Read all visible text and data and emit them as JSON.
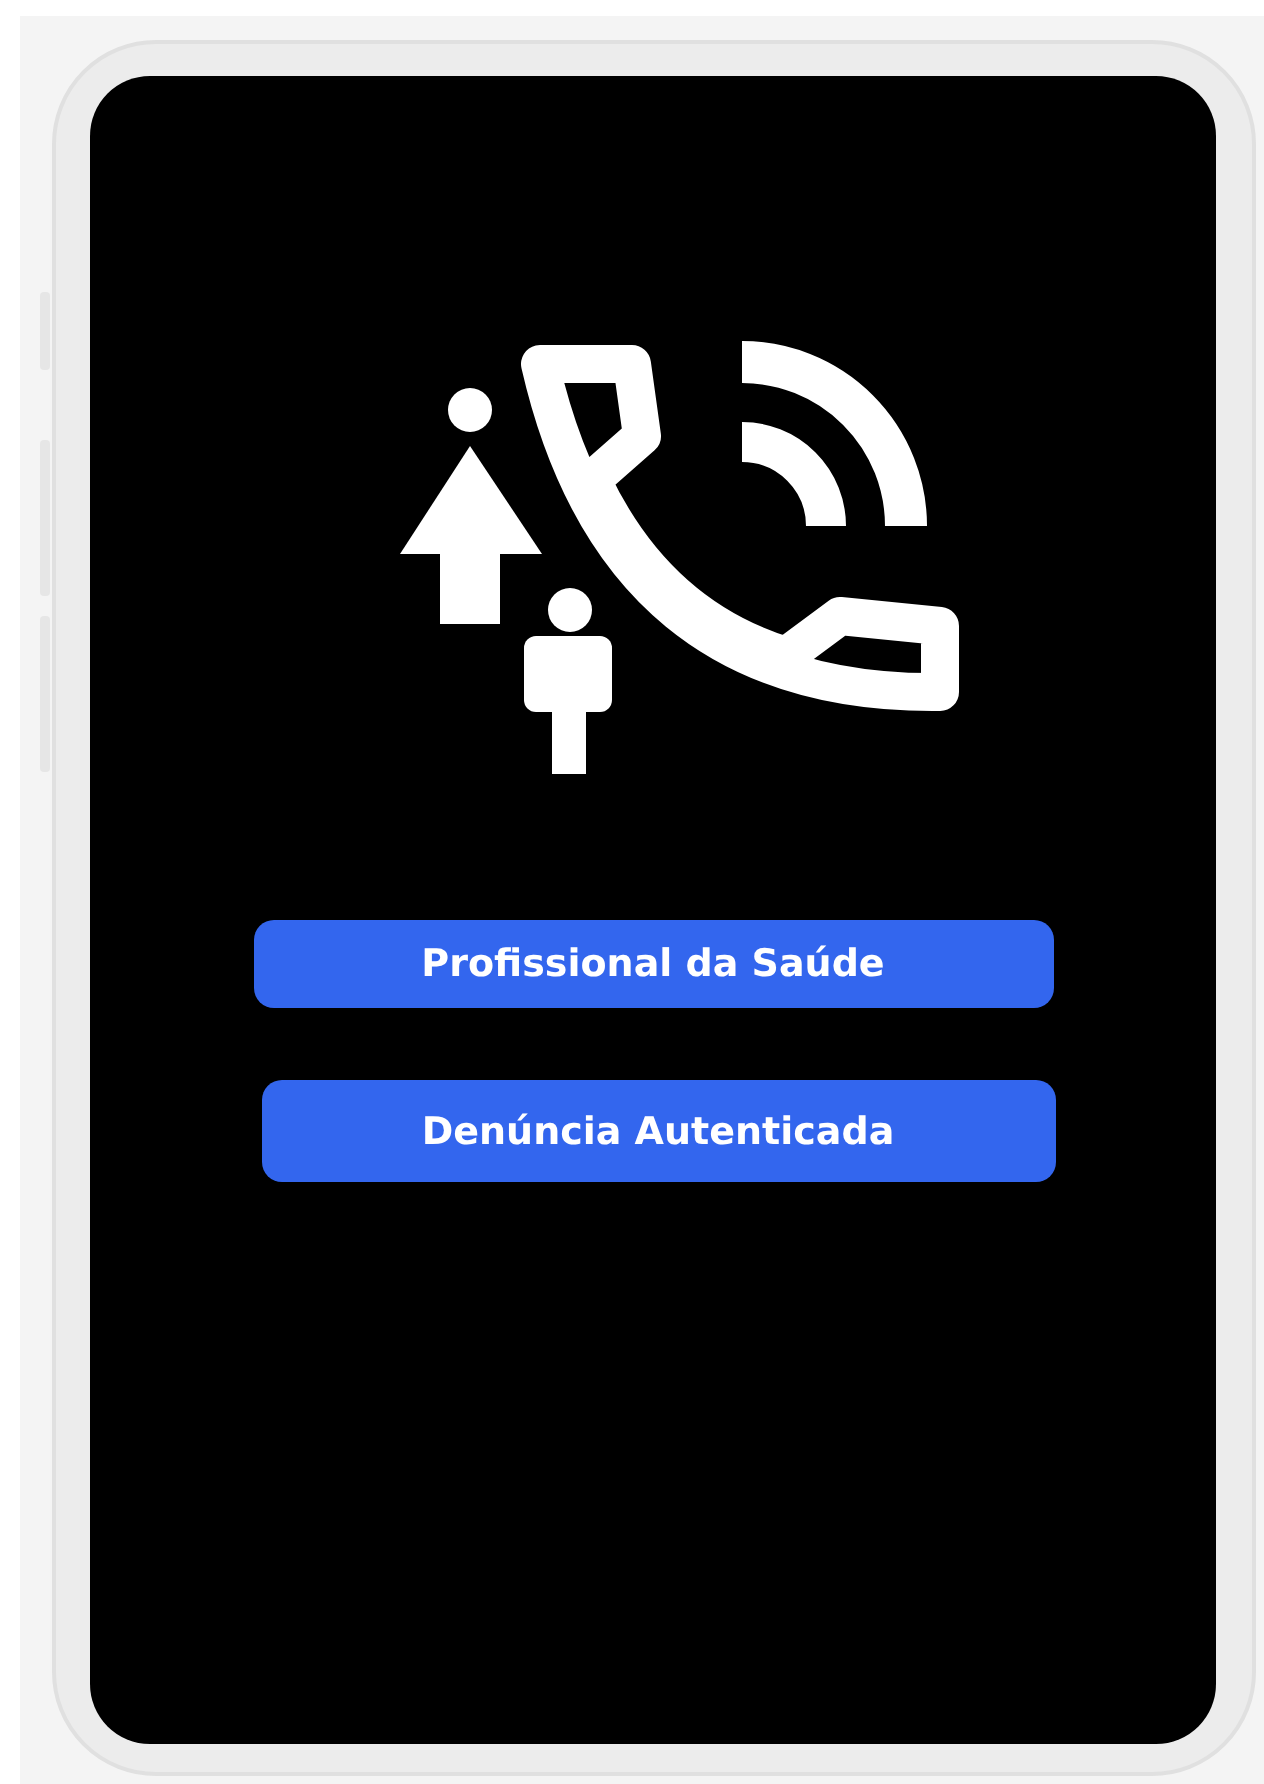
{
  "buttons": [
    {
      "label": "Profissional da Saúde"
    },
    {
      "label": "Denúncia Autenticada"
    }
  ]
}
